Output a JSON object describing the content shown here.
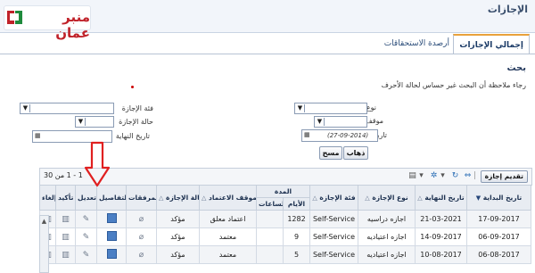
{
  "logo": {
    "text": "منبر عمان"
  },
  "page_title": "الإجازات",
  "tabs": [
    {
      "label": "إجمالي الإجازات",
      "active": true
    },
    {
      "label": "أرصدة الاستحقاقات",
      "active": false
    }
  ],
  "search": {
    "title": "بحث",
    "note": "رجاء ملاحظة أن البحث غير حساس لحالة الأحرف",
    "fields": {
      "leave_type_label": "نوع الإجازة",
      "leave_category_label": "فئة الإجازة",
      "approval_status_label": "موقف الاعتماد",
      "leave_status_label": "حالة الإجازة",
      "start_date_label": "تاريخ البداية",
      "start_date_placeholder": "(27-09-2014)",
      "end_date_label": "تاريخ النهاية"
    },
    "go_button": "ذهاب",
    "clear_button": "مسح"
  },
  "toolbar": {
    "submit_button": "تقديم إجازة",
    "pager_text": "1 - 1 من 30"
  },
  "table": {
    "headers": {
      "start_date": "تاريخ البداية",
      "end_date": "تاريخ النهاية",
      "leave_type": "نوع الإجازة",
      "leave_category": "فئة الإجازة",
      "duration": "المدة",
      "duration_days": "الأيام",
      "duration_hours": "الساعات",
      "approval_status": "موقف الاعتماد",
      "leave_status": "حالة الإجازة",
      "attachments": "المرفقات",
      "details": "التفاصيل",
      "edit": "تعديل",
      "confirm": "تأكيد",
      "cancel": "إلغاء"
    },
    "rows": [
      {
        "start_date": "17-09-2017",
        "end_date": "21-03-2021",
        "leave_type": "اجازه دراسيه",
        "leave_category": "Self-Service",
        "days": "1282",
        "hours": "",
        "approval_status": "اعتماد معلق",
        "leave_status": "مؤكد"
      },
      {
        "start_date": "06-09-2017",
        "end_date": "14-09-2017",
        "leave_type": "اجازه اعتياديه",
        "leave_category": "Self-Service",
        "days": "9",
        "hours": "",
        "approval_status": "معتمد",
        "leave_status": "مؤكد"
      },
      {
        "start_date": "06-08-2017",
        "end_date": "10-08-2017",
        "leave_type": "اجازه اعتياديه",
        "leave_category": "Self-Service",
        "days": "5",
        "hours": "",
        "approval_status": "معتمد",
        "leave_status": "مؤكد"
      }
    ]
  },
  "colors": {
    "accent": "#e9a13b",
    "header_bg": "#e8ecf2",
    "annotation_arrow": "#e02020",
    "logo_red": "#c0222a"
  }
}
